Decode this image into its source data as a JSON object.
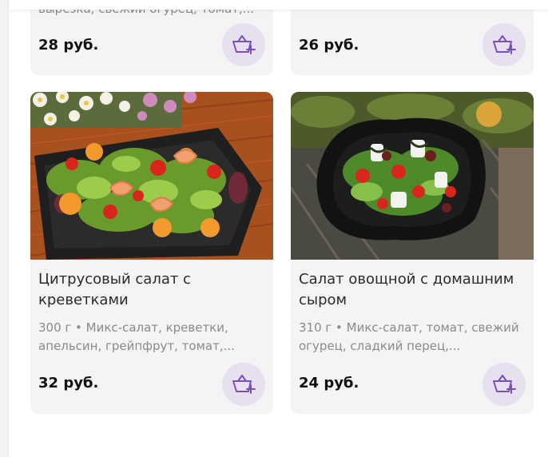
{
  "colors": {
    "accent": "#7b4fb8",
    "cart_button_bg": "#e7e1ef",
    "card_bg": "#f4f4f5"
  },
  "cards": [
    {
      "description": "вырезка, свежий огурец, томат,...",
      "price": "28 руб.",
      "cart_icon": "basket-plus-icon"
    },
    {
      "description": "",
      "price": "26 руб.",
      "cart_icon": "basket-plus-icon"
    },
    {
      "title": "Цитрусовый салат с креветками",
      "description": "300 г • Микс-салат, креветки, апельсин, грейпфрут, томат,...",
      "price": "32 руб.",
      "cart_icon": "basket-plus-icon"
    },
    {
      "title": "Салат овощной с домашним сыром",
      "description": "310 г • Микс-салат, томат, свежий огурец, сладкий перец,...",
      "price": "24 руб.",
      "cart_icon": "basket-plus-icon"
    }
  ]
}
